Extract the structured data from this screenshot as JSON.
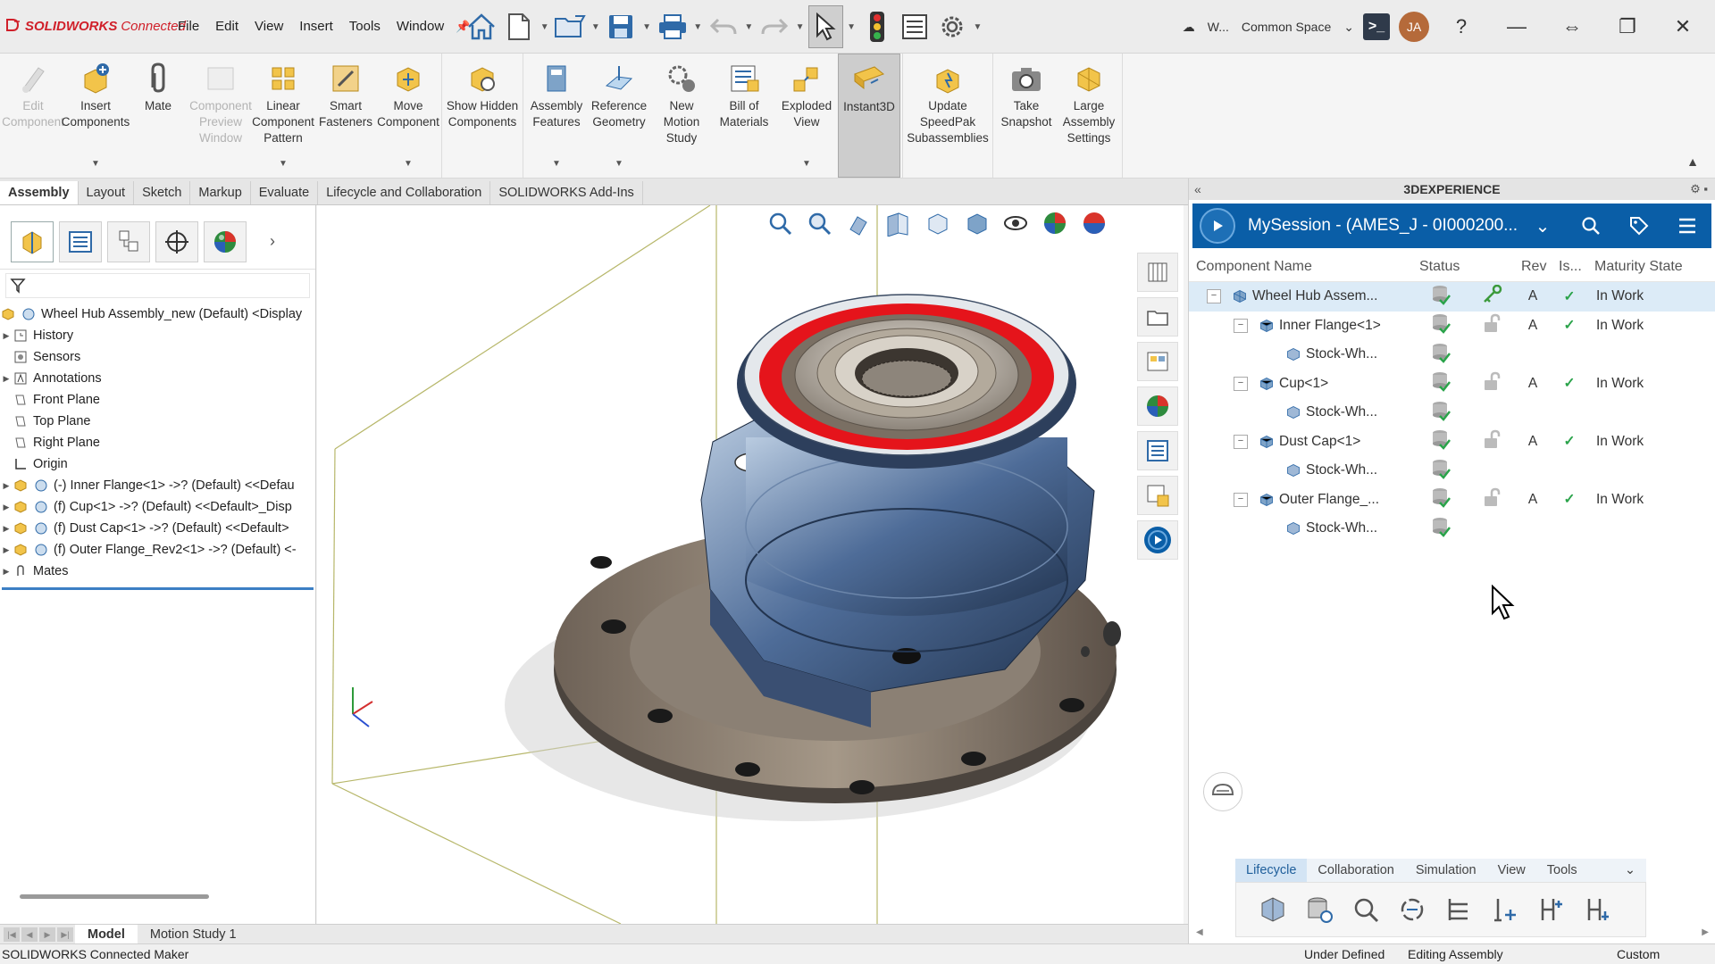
{
  "app": {
    "logo_text": "SOLIDWORKS",
    "logo_suffix": "Connected",
    "menus": [
      "File",
      "Edit",
      "View",
      "Insert",
      "Tools",
      "Window"
    ]
  },
  "topbar": {
    "workspace_short": "W...",
    "space_label": "Common Space",
    "avatar_initials": "JA"
  },
  "ribbon": {
    "buttons": [
      {
        "label": "Edit Component"
      },
      {
        "label": "Insert Components"
      },
      {
        "label": "Mate"
      },
      {
        "label": "Component Preview Window"
      },
      {
        "label": "Linear Component Pattern"
      },
      {
        "label": "Smart Fasteners"
      },
      {
        "label": "Move Component"
      },
      {
        "label": "Show Hidden Components"
      },
      {
        "label": "Assembly Features"
      },
      {
        "label": "Reference Geometry"
      },
      {
        "label": "New Motion Study"
      },
      {
        "label": "Bill of Materials"
      },
      {
        "label": "Exploded View"
      },
      {
        "label": "Instant3D"
      },
      {
        "label": "Update SpeedPak Subassemblies"
      },
      {
        "label": "Take Snapshot"
      },
      {
        "label": "Large Assembly Settings"
      }
    ]
  },
  "command_tabs": [
    "Assembly",
    "Layout",
    "Sketch",
    "Markup",
    "Evaluate",
    "Lifecycle and Collaboration",
    "SOLIDWORKS Add-Ins"
  ],
  "feature_tree": {
    "root": "Wheel Hub Assembly_new (Default) <Display",
    "items": [
      {
        "label": "History"
      },
      {
        "label": "Sensors"
      },
      {
        "label": "Annotations"
      },
      {
        "label": "Front Plane"
      },
      {
        "label": "Top Plane"
      },
      {
        "label": "Right Plane"
      },
      {
        "label": "Origin"
      },
      {
        "label": "(-) Inner Flange<1> ->? (Default) <<Defau"
      },
      {
        "label": "(f) Cup<1> ->? (Default) <<Default>_Disp"
      },
      {
        "label": "(f) Dust Cap<1> ->? (Default) <<Default>"
      },
      {
        "label": "(f) Outer Flange_Rev2<1> ->? (Default) <-"
      },
      {
        "label": "Mates"
      }
    ]
  },
  "bottom_tabs": [
    "Model",
    "Motion Study 1"
  ],
  "status_bar": {
    "left": "SOLIDWORKS Connected Maker",
    "state": "Under Defined",
    "mode": "Editing Assembly",
    "units": "Custom"
  },
  "dx_panel": {
    "title": "3DEXPERIENCE",
    "session": "MySession - (AMES_J - 0I000200...",
    "columns": [
      "Component Name",
      "Status",
      "Rev",
      "Is...",
      "Maturity State"
    ],
    "rows": [
      {
        "name": "Wheel Hub Assem...",
        "rev": "A",
        "is": "✓",
        "maturity": "In Work"
      },
      {
        "name": "Inner Flange<1>",
        "rev": "A",
        "is": "✓",
        "maturity": "In Work"
      },
      {
        "name": "Stock-Wh...",
        "rev": "",
        "is": "",
        "maturity": ""
      },
      {
        "name": "Cup<1>",
        "rev": "A",
        "is": "✓",
        "maturity": "In Work"
      },
      {
        "name": "Stock-Wh...",
        "rev": "",
        "is": "",
        "maturity": ""
      },
      {
        "name": "Dust Cap<1>",
        "rev": "A",
        "is": "✓",
        "maturity": "In Work"
      },
      {
        "name": "Stock-Wh...",
        "rev": "",
        "is": "",
        "maturity": ""
      },
      {
        "name": "Outer Flange_...",
        "rev": "A",
        "is": "✓",
        "maturity": "In Work"
      },
      {
        "name": "Stock-Wh...",
        "rev": "",
        "is": "",
        "maturity": ""
      }
    ],
    "tabs": [
      "Lifecycle",
      "Collaboration",
      "Simulation",
      "View",
      "Tools"
    ]
  },
  "colors": {
    "brand_red": "#d0202a",
    "dx_blue": "#0a5ea7",
    "ok_green": "#2aa34a",
    "selection_blue": "#dcebf7"
  }
}
